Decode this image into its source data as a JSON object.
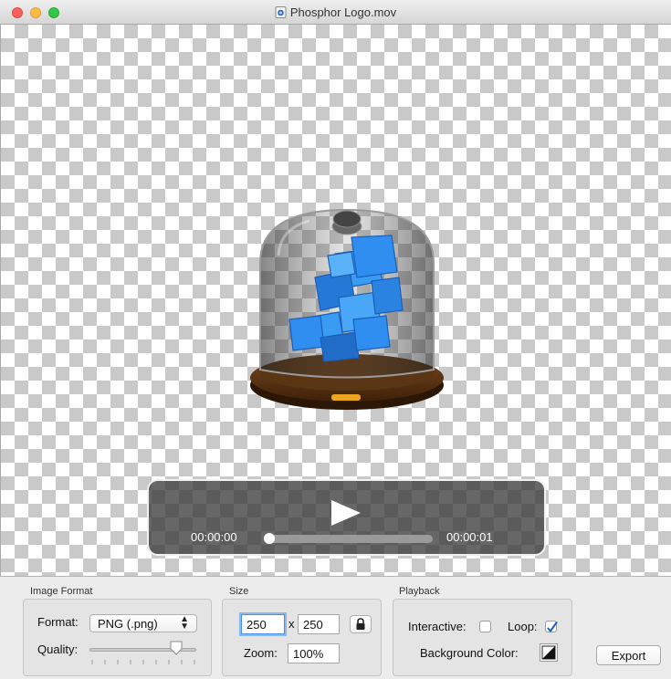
{
  "window": {
    "title": "Phosphor Logo.mov",
    "title_icon": "quicktime-movie-icon"
  },
  "player": {
    "current_time": "00:00:00",
    "end_time": "00:00:01",
    "progress": 0
  },
  "image_format": {
    "group_label": "Image Format",
    "format_label": "Format:",
    "format_value": "PNG (.png)",
    "quality_label": "Quality:",
    "quality": 0.85
  },
  "size": {
    "group_label": "Size",
    "width": "250",
    "times": "x",
    "height": "250",
    "zoom_label": "Zoom:",
    "zoom_value": "100%"
  },
  "playback": {
    "group_label": "Playback",
    "interactive_label": "Interactive:",
    "interactive_checked": false,
    "loop_label": "Loop:",
    "loop_checked": true,
    "background_label": "Background Color:"
  },
  "export_label": "Export",
  "colors": {
    "cube_blue": "#2f8ef0",
    "accent_focus": "#4a90e2",
    "hud_bg": "#3c3c3c"
  }
}
